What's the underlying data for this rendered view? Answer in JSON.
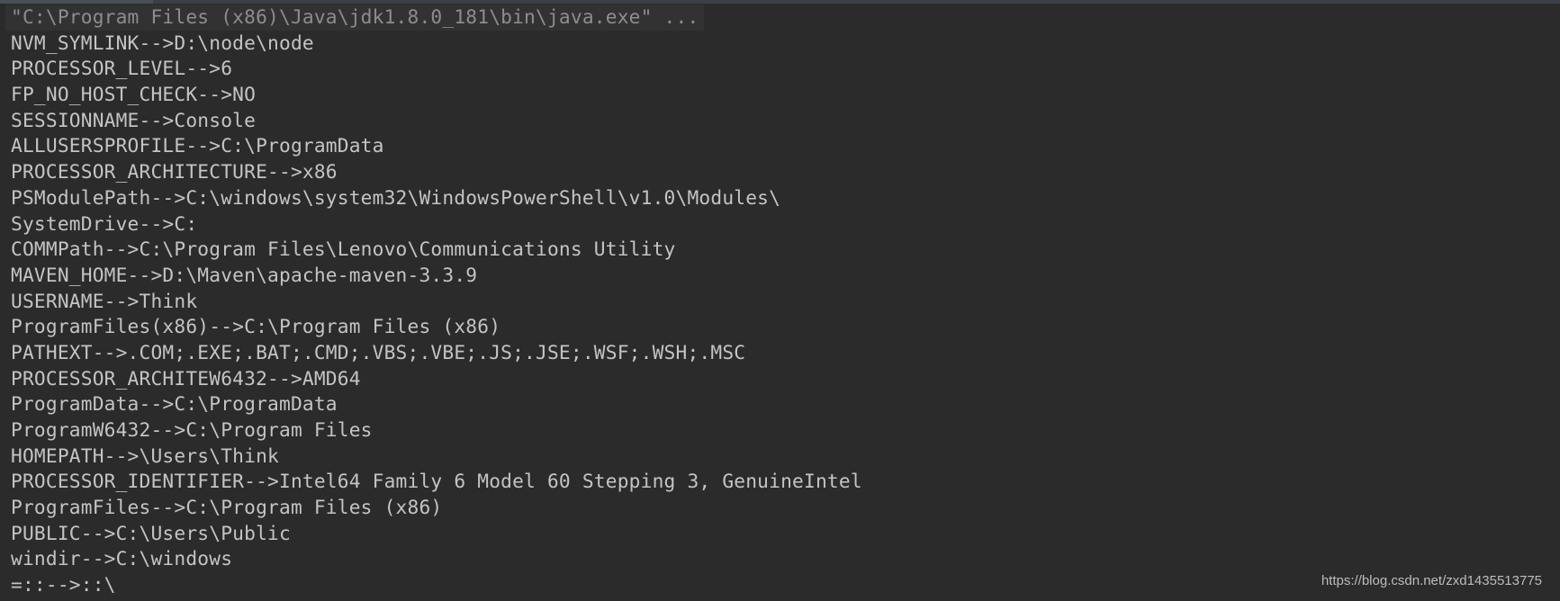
{
  "console": {
    "command": "\"C:\\Program Files (x86)\\Java\\jdk1.8.0_181\\bin\\java.exe\" ...",
    "lines": [
      "NVM_SYMLINK-->D:\\node\\node",
      "PROCESSOR_LEVEL-->6",
      "FP_NO_HOST_CHECK-->NO",
      "SESSIONNAME-->Console",
      "ALLUSERSPROFILE-->C:\\ProgramData",
      "PROCESSOR_ARCHITECTURE-->x86",
      "PSModulePath-->C:\\windows\\system32\\WindowsPowerShell\\v1.0\\Modules\\",
      "SystemDrive-->C:",
      "COMMPath-->C:\\Program Files\\Lenovo\\Communications Utility",
      "MAVEN_HOME-->D:\\Maven\\apache-maven-3.3.9",
      "USERNAME-->Think",
      "ProgramFiles(x86)-->C:\\Program Files (x86)",
      "PATHEXT-->.COM;.EXE;.BAT;.CMD;.VBS;.VBE;.JS;.JSE;.WSF;.WSH;.MSC",
      "PROCESSOR_ARCHITEW6432-->AMD64",
      "ProgramData-->C:\\ProgramData",
      "ProgramW6432-->C:\\Program Files",
      "HOMEPATH-->\\Users\\Think",
      "PROCESSOR_IDENTIFIER-->Intel64 Family 6 Model 60 Stepping 3, GenuineIntel",
      "ProgramFiles-->C:\\Program Files (x86)",
      "PUBLIC-->C:\\Users\\Public",
      "windir-->C:\\windows",
      "=::-->::\\"
    ]
  },
  "watermark": "https://blog.csdn.net/zxd1435513775",
  "colors": {
    "background": "#2b2b2b",
    "text": "#c4c4c4",
    "command": "#8d8d8d"
  }
}
